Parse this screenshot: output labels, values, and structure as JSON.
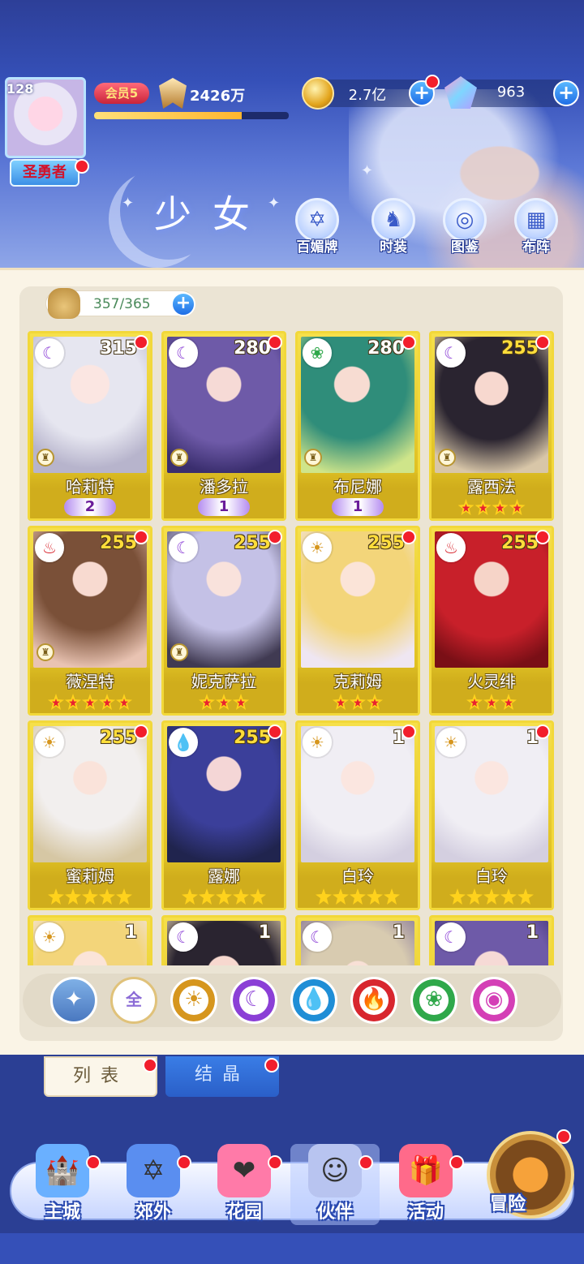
{
  "player": {
    "level": "128",
    "title": "圣勇者",
    "vip": "会员5",
    "power": "2426万",
    "exp_progress": 0.76
  },
  "currencies": [
    {
      "name": "gold",
      "value": "2.7亿",
      "icon": "gold-coin-icon"
    },
    {
      "name": "diamond",
      "value": "963",
      "icon": "diamond-icon"
    }
  ],
  "page_title": "少女",
  "quick_actions": [
    {
      "label": "百媚牌",
      "icon": "card-icon"
    },
    {
      "label": "时装",
      "icon": "costume-icon"
    },
    {
      "label": "图鉴",
      "icon": "book-icon"
    },
    {
      "label": "布阵",
      "icon": "grid-icon"
    }
  ],
  "capacity": "357/365",
  "cards": [
    {
      "name": "哈莉特",
      "level": "315",
      "element": "moon",
      "grade_type": "wing",
      "grade": "2",
      "art": "silver",
      "gold_level": false,
      "rook": true,
      "frame": "diamond"
    },
    {
      "name": "潘多拉",
      "level": "280",
      "element": "moon",
      "grade_type": "wing",
      "grade": "1",
      "art": "purple",
      "gold_level": false,
      "rook": true
    },
    {
      "name": "布尼娜",
      "level": "280",
      "element": "wind",
      "grade_type": "wing",
      "grade": "1",
      "art": "green",
      "gold_level": false,
      "rook": true
    },
    {
      "name": "露西法",
      "level": "255",
      "element": "moon",
      "grade_type": "red_stars",
      "stars": 4,
      "art": "black",
      "gold_level": true,
      "rook": true
    },
    {
      "name": "薇涅特",
      "level": "255",
      "element": "fire",
      "grade_type": "red_stars",
      "stars": 5,
      "art": "brown",
      "gold_level": true,
      "rook": true
    },
    {
      "name": "妮克萨拉",
      "level": "255",
      "element": "moon",
      "grade_type": "red_stars",
      "stars": 3,
      "art": "lavender",
      "gold_level": true,
      "rook": true
    },
    {
      "name": "克莉姆",
      "level": "255",
      "element": "sun",
      "grade_type": "red_stars",
      "stars": 3,
      "art": "blonde",
      "gold_level": true,
      "rook": false
    },
    {
      "name": "火灵绯",
      "level": "255",
      "element": "fire",
      "grade_type": "red_stars",
      "stars": 3,
      "art": "red",
      "gold_level": true,
      "rook": false
    },
    {
      "name": "蜜莉姆",
      "level": "255",
      "element": "sun",
      "grade_type": "gold_stars",
      "stars": 5,
      "art": "whitecat",
      "gold_level": true,
      "rook": false
    },
    {
      "name": "露娜",
      "level": "255",
      "element": "water",
      "grade_type": "gold_stars",
      "stars": 5,
      "art": "navy",
      "gold_level": true,
      "rook": false
    },
    {
      "name": "白玲",
      "level": "1",
      "element": "sun",
      "grade_type": "gold_stars",
      "stars": 5,
      "art": "white",
      "gold_level": false,
      "rook": false
    },
    {
      "name": "白玲",
      "level": "1",
      "element": "sun",
      "grade_type": "gold_stars",
      "stars": 5,
      "art": "white",
      "gold_level": false,
      "rook": false
    },
    {
      "name": "",
      "level": "1",
      "element": "sun",
      "grade_type": "none",
      "art": "blonde",
      "gold_level": false,
      "rook": false
    },
    {
      "name": "",
      "level": "1",
      "element": "moon",
      "grade_type": "none",
      "art": "black",
      "gold_level": false,
      "rook": false
    },
    {
      "name": "",
      "level": "1",
      "element": "moon",
      "grade_type": "none",
      "art": "mixed",
      "gold_level": false,
      "rook": false
    },
    {
      "name": "",
      "level": "1",
      "element": "moon",
      "grade_type": "none",
      "art": "purple",
      "gold_level": false,
      "rook": false
    }
  ],
  "filters": [
    {
      "name": "star",
      "label": "✦",
      "color": "#5a86c8"
    },
    {
      "name": "all",
      "label": "全",
      "color": "#8b6bd6"
    },
    {
      "name": "sun",
      "label": "☀",
      "color": "#d6961e"
    },
    {
      "name": "moon",
      "label": "☾",
      "color": "#8b3fd6"
    },
    {
      "name": "water",
      "label": "💧",
      "color": "#1f8ed6"
    },
    {
      "name": "fire",
      "label": "🔥",
      "color": "#d8262e"
    },
    {
      "name": "wind",
      "label": "❀",
      "color": "#2fa84a"
    },
    {
      "name": "light",
      "label": "◉",
      "color": "#d43fb6"
    }
  ],
  "tabs": [
    {
      "label": "列表",
      "active": true
    },
    {
      "label": "结晶",
      "active": false
    }
  ],
  "nav": [
    {
      "label": "主城",
      "icon": "castle-icon"
    },
    {
      "label": "郊外",
      "icon": "portal-icon"
    },
    {
      "label": "花园",
      "icon": "heart-icon"
    },
    {
      "label": "伙伴",
      "icon": "partner-icon",
      "active": true
    },
    {
      "label": "活动",
      "icon": "gift-icon"
    },
    {
      "label": "冒险",
      "icon": "compass-icon"
    }
  ]
}
